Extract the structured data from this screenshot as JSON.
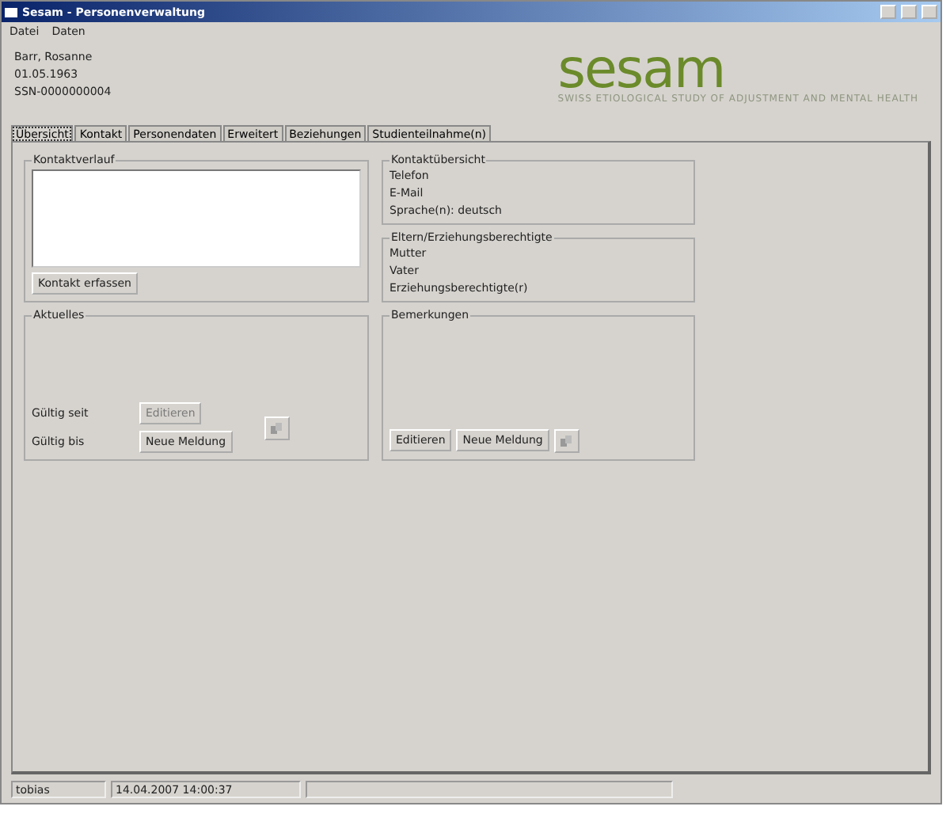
{
  "window": {
    "title": "Sesam - Personenverwaltung"
  },
  "menu": [
    "Datei",
    "Daten"
  ],
  "person": [
    "Barr, Rosanne",
    "01.05.1963",
    "SSN-0000000004"
  ],
  "logo": {
    "name": "sesam",
    "subtitle": "SWISS ETIOLOGICAL STUDY OF ADJUSTMENT AND MENTAL HEALTH"
  },
  "tabs": [
    {
      "label": "Übersicht",
      "selected": true
    },
    {
      "label": "Kontakt",
      "selected": false
    },
    {
      "label": "Personendaten",
      "selected": false
    },
    {
      "label": "Erweitert",
      "selected": false
    },
    {
      "label": "Beziehungen",
      "selected": false
    },
    {
      "label": "Studienteilnahme(n)",
      "selected": false
    }
  ],
  "kontaktverlauf": {
    "title": "Kontaktverlauf",
    "button": {
      "label": "Kontakt erfassen",
      "disabled": false
    }
  },
  "aktuelles": {
    "title": "Aktuelles",
    "rows": [
      {
        "label": "Gültig seit",
        "button": {
          "label": "Editieren",
          "disabled": true
        }
      },
      {
        "label": "Gültig bis",
        "button": {
          "label": "Neue Meldung",
          "disabled": false
        }
      }
    ]
  },
  "kontaktuebersicht": {
    "title": "Kontaktübersicht",
    "lines": [
      "Telefon",
      "E-Mail",
      "Sprache(n):  deutsch"
    ]
  },
  "eltern": {
    "title": "Eltern/Erziehungsberechtigte",
    "lines": [
      "Mutter",
      "Vater",
      "Erziehungsberechtigte(r)"
    ]
  },
  "bemerkungen": {
    "title": "Bemerkungen",
    "buttons": [
      {
        "label": "Editieren",
        "disabled": false
      },
      {
        "label": "Neue Meldung",
        "disabled": false
      }
    ]
  },
  "status_bar": [
    "tobias",
    "14.04.2007 14:00:37"
  ]
}
